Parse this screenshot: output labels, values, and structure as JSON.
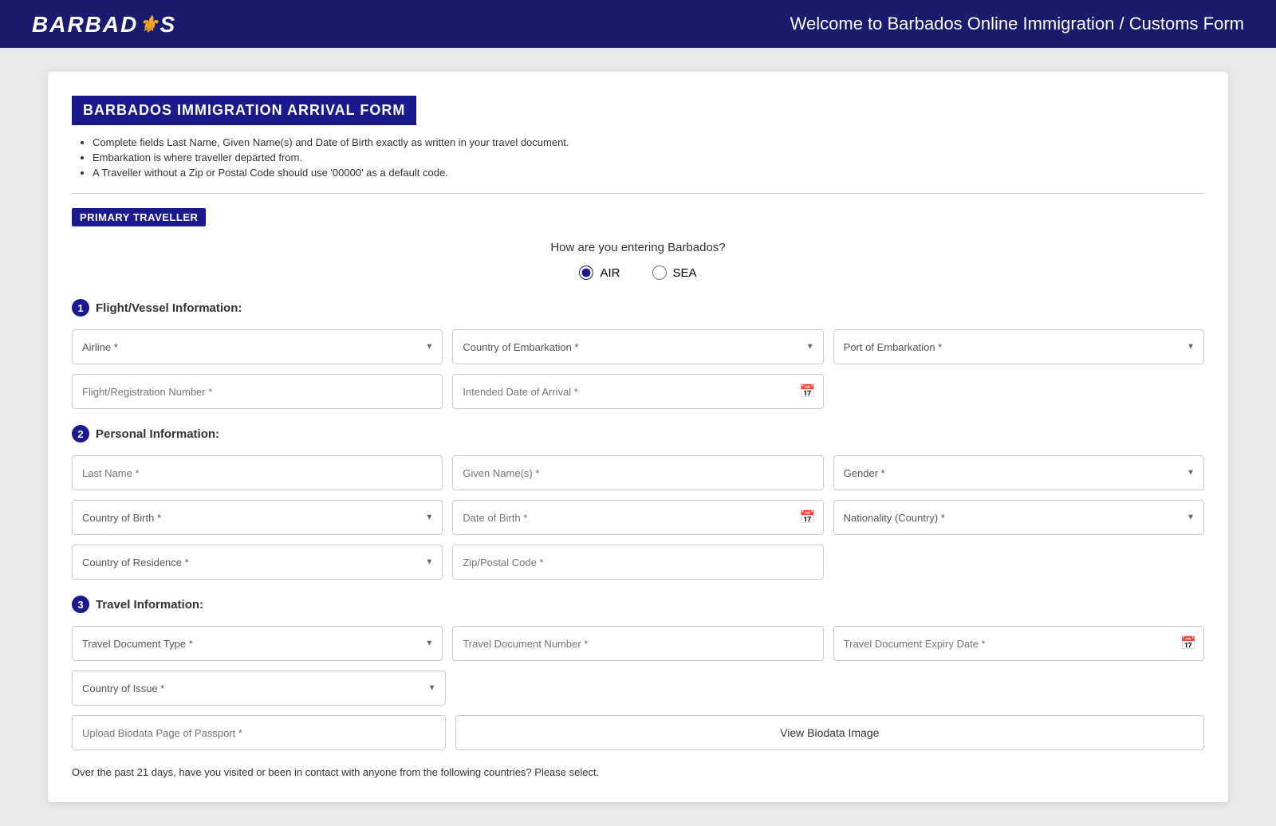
{
  "header": {
    "logo_text": "BARBADOS",
    "title": "Welcome to Barbados Online Immigration / Customs Form"
  },
  "form": {
    "title": "BARBADOS IMMIGRATION ARRIVAL FORM",
    "instructions": [
      "Complete fields Last Name, Given Name(s) and Date of Birth exactly as written in your travel document.",
      "Embarkation is where traveller departed from.",
      "A Traveller without a Zip or Postal Code should use '00000' as a default code."
    ],
    "primary_traveller_label": "PRIMARY TRAVELLER",
    "entry_question": "How are you entering Barbados?",
    "entry_options": [
      "AIR",
      "SEA"
    ],
    "entry_selected": "AIR",
    "sections": {
      "flight": {
        "number": "1",
        "title": "Flight/Vessel Information:",
        "fields": {
          "airline": "Airline *",
          "country_embarkation": "Country of Embarkation *",
          "port_embarkation": "Port of Embarkation *",
          "flight_number": "Flight/Registration Number *",
          "arrival_date": "Intended Date of Arrival *"
        }
      },
      "personal": {
        "number": "2",
        "title": "Personal Information:",
        "fields": {
          "last_name": "Last Name *",
          "given_names": "Given Name(s) *",
          "gender": "Gender *",
          "country_birth": "Country of Birth *",
          "date_birth": "Date of Birth *",
          "nationality": "Nationality (Country) *",
          "country_residence": "Country of Residence *",
          "zip_postal": "Zip/Postal Code *"
        }
      },
      "travel": {
        "number": "3",
        "title": "Travel Information:",
        "fields": {
          "doc_type": "Travel Document Type *",
          "doc_number": "Travel Document Number *",
          "doc_expiry": "Travel Document Expiry Date *",
          "country_issue": "Country of Issue *",
          "upload_biodata": "Upload Biodata Page of Passport *",
          "view_biodata_btn": "View Biodata Image"
        }
      }
    },
    "footer_question": "Over the past 21 days, have you visited or been in contact with anyone from the following countries? Please select."
  }
}
